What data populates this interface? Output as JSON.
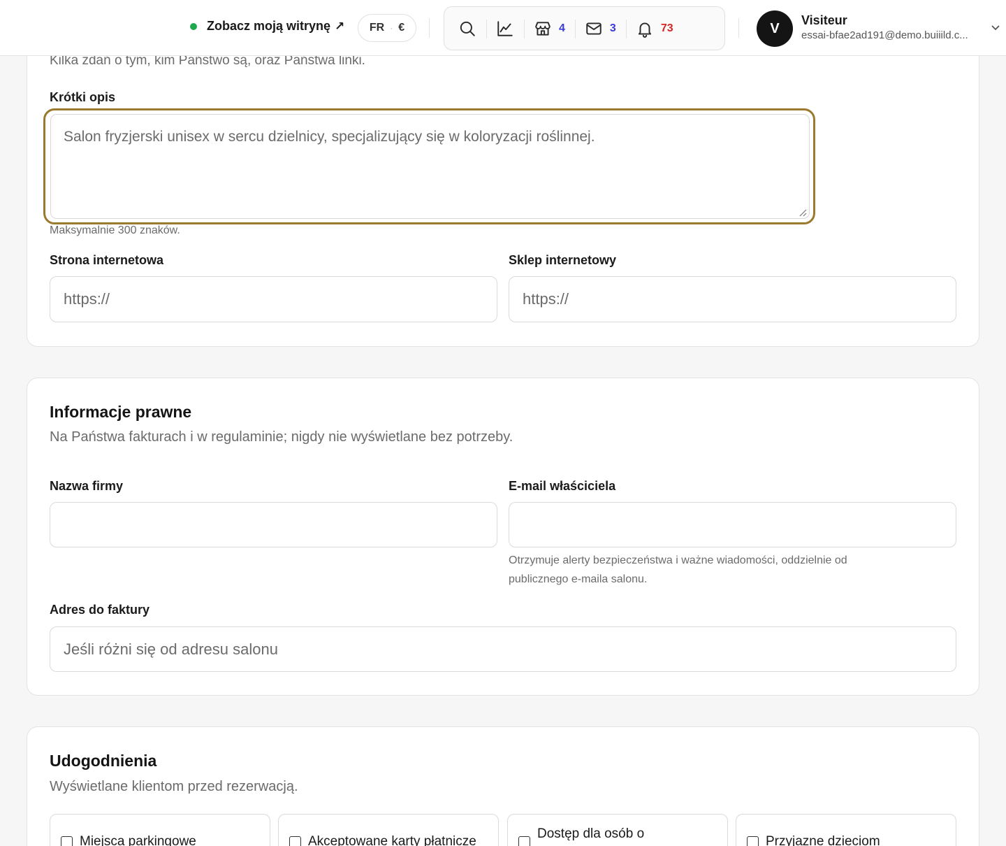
{
  "topbar": {
    "site_link_label": "Zobacz moją witrynę",
    "site_link_arrow": "↗",
    "locale": {
      "language": "FR",
      "currency": "€"
    },
    "tools": {
      "shop_count": "4",
      "mail_count": "3",
      "notif_count": "73"
    },
    "user": {
      "initial": "V",
      "name": "Visiteur",
      "email": "essai-bfae2ad191@demo.buiiild.c..."
    }
  },
  "about": {
    "intro": "Kilka zdań o tym, kim Państwo są, oraz Państwa linki.",
    "short_desc_label": "Krótki opis",
    "short_desc_value": "Salon fryzjerski unisex w sercu dzielnicy, specjalizujący się w koloryzacji roślinnej.",
    "short_desc_helper": "Maksymalnie 300 znaków.",
    "website_label": "Strona internetowa",
    "website_placeholder": "https://",
    "shop_label": "Sklep internetowy",
    "shop_placeholder": "https://"
  },
  "legal": {
    "title": "Informacje prawne",
    "subtitle": "Na Państwa fakturach i w regulaminie; nigdy nie wyświetlane bez potrzeby.",
    "company_label": "Nazwa firmy",
    "company_value": "",
    "owner_email_label": "E-mail właściciela",
    "owner_email_value": "",
    "owner_email_helper_line1": "Otrzymuje alerty bezpieczeństwa i ważne wiadomości, oddzielnie od",
    "owner_email_helper_line2": "publicznego e-maila salonu.",
    "billing_label": "Adres do faktury",
    "billing_placeholder": "Jeśli różni się od adresu salonu"
  },
  "amenities": {
    "title": "Udogodnienia",
    "subtitle": "Wyświetlane klientom przed rezerwacją.",
    "items": [
      {
        "label": "Miejsca parkingowe",
        "checked": false
      },
      {
        "label": "Akceptowane karty płatnicze",
        "checked": false
      },
      {
        "label": "Dostęp dla osób o",
        "checked": false
      },
      {
        "label": "Przyjazne dzieciom",
        "checked": false
      }
    ]
  },
  "colors": {
    "accent_focus": "#9a7a2e",
    "status_online": "#1fa84f",
    "count_blue": "#3a3ad4",
    "count_red": "#d42626"
  }
}
